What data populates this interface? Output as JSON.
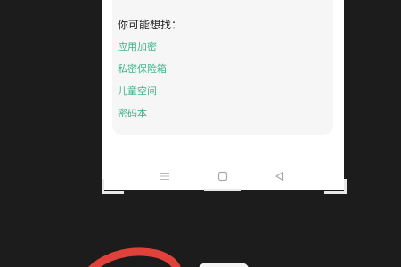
{
  "suggestions": {
    "title": "你可能想找：",
    "items": [
      {
        "label": "应用加密"
      },
      {
        "label": "私密保险箱"
      },
      {
        "label": "儿童空间"
      },
      {
        "label": "密码本"
      }
    ]
  },
  "nav_bar": {
    "icons": [
      "menu-icon",
      "home-square-icon",
      "back-triangle-icon"
    ]
  },
  "colors": {
    "background": "#1c1c1c",
    "screen": "#ffffff",
    "card": "#f6f6f6",
    "link": "#3cb48a",
    "title": "#222222",
    "scribble": "#e0413a"
  }
}
